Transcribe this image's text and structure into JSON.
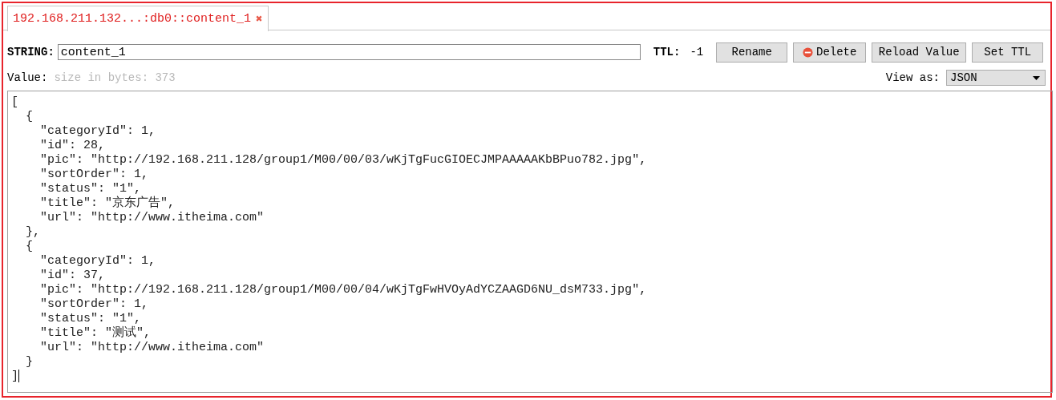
{
  "tabs": [
    {
      "label": "192.168.211.132...:db0::content_1",
      "selected": true,
      "close": "✖"
    }
  ],
  "key": {
    "type_label": "STRING:",
    "name": "content_1"
  },
  "ttl": {
    "label": "TTL:",
    "value": "-1"
  },
  "buttons": [
    {
      "label": "Rename",
      "kind": "plain"
    },
    {
      "label": "Delete",
      "kind": "delete"
    },
    {
      "label": "Reload Value",
      "kind": "plain"
    },
    {
      "label": "Set TTL",
      "kind": "plain"
    }
  ],
  "value": {
    "label": "Value:",
    "size": "size in bytes: 373"
  },
  "view_as": {
    "label": "View as:",
    "selected": "JSON"
  },
  "editor_lines": [
    "[",
    "  {",
    "    \"categoryId\": 1,",
    "    \"id\": 28,",
    "    \"pic\": \"http://192.168.211.128/group1/M00/00/03/wKjTgFucGIOECJMPAAAAAKbBPuo782.jpg\",",
    "    \"sortOrder\": 1,",
    "    \"status\": \"1\",",
    "    \"title\": \"京东广告\",",
    "    \"url\": \"http://www.itheima.com\"",
    "  },",
    "  {",
    "    \"categoryId\": 1,",
    "    \"id\": 37,",
    "    \"pic\": \"http://192.168.211.128/group1/M00/00/04/wKjTgFwHVOyAdYCZAAGD6NU_dsM733.jpg\",",
    "    \"sortOrder\": 1,",
    "    \"status\": \"1\",",
    "    \"title\": \"测试\",",
    "    \"url\": \"http://www.itheima.com\"",
    "  }",
    "]"
  ]
}
